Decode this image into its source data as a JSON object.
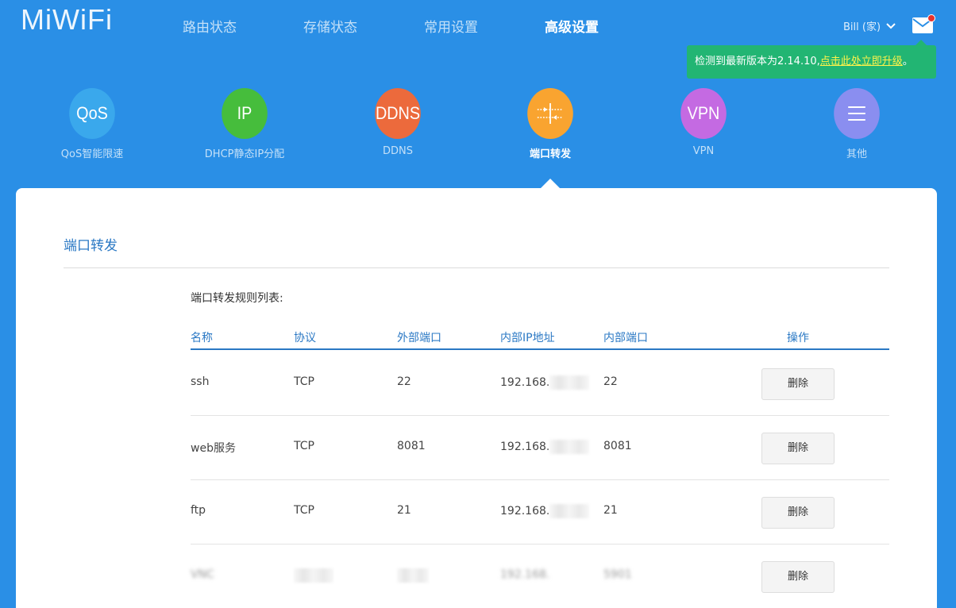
{
  "brand": {
    "logo": "MiWiFi"
  },
  "nav": {
    "items": [
      "路由状态",
      "存储状态",
      "常用设置",
      "高级设置"
    ],
    "active": "高级设置"
  },
  "user": {
    "name": "Bill (家)"
  },
  "notice": {
    "text": "检测到最新版本为2.14.10,",
    "link": "点击此处立即升级",
    "suffix": "。",
    "color": "#22b573"
  },
  "apps": [
    {
      "icon": "QoS",
      "label": "QoS智能限速",
      "color": "#3aa8ec"
    },
    {
      "icon": "IP",
      "label": "DHCP静态IP分配",
      "color": "#46bd3c"
    },
    {
      "icon": "DDNS",
      "label": "DDNS",
      "color": "#ec6a3c"
    },
    {
      "icon": "port-forward-icon",
      "label": "端口转发",
      "color": "#f9a430",
      "active": true
    },
    {
      "icon": "VPN",
      "label": "VPN",
      "color": "#c46ae2"
    },
    {
      "icon": "menu-icon",
      "label": "其他",
      "color": "#8a8ef0"
    }
  ],
  "section": {
    "title": "端口转发",
    "caption": "端口转发规则列表:",
    "columns": [
      "名称",
      "协议",
      "外部端口",
      "内部IP地址",
      "内部端口",
      "操作"
    ],
    "rows": [
      {
        "name": "ssh",
        "protocol": "TCP",
        "ext_port": "22",
        "ip": "192.168.",
        "int_port": "22",
        "action": "删除"
      },
      {
        "name": "web服务",
        "protocol": "TCP",
        "ext_port": "8081",
        "ip": "192.168.",
        "int_port": "8081",
        "action": "删除"
      },
      {
        "name": "ftp",
        "protocol": "TCP",
        "ext_port": "21",
        "ip": "192.168.",
        "int_port": "21",
        "action": "删除"
      },
      {
        "name": "VNC",
        "protocol": "",
        "ext_port": "",
        "ip": "192.168.",
        "int_port": "5901",
        "action": "删除"
      }
    ]
  },
  "colors": {
    "background": "#2a8fe6",
    "accent": "#2a78c4"
  }
}
